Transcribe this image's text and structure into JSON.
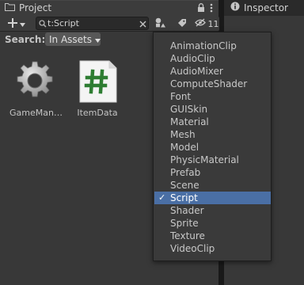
{
  "tabs": {
    "project": "Project",
    "inspector": "Inspector"
  },
  "toolbar": {
    "search_value": "t:Script",
    "hidden_count": "11"
  },
  "searchbar": {
    "label": "Search:",
    "scope": "In Assets"
  },
  "assets": [
    {
      "label": "GameMan…",
      "icon": "gear-icon"
    },
    {
      "label": "ItemData",
      "icon": "csharp-script-icon"
    }
  ],
  "dropdown": {
    "items": [
      "AnimationClip",
      "AudioClip",
      "AudioMixer",
      "ComputeShader",
      "Font",
      "GUISkin",
      "Material",
      "Mesh",
      "Model",
      "PhysicMaterial",
      "Prefab",
      "Scene",
      "Script",
      "Shader",
      "Sprite",
      "Texture",
      "VideoClip"
    ],
    "selected": "Script",
    "check": "✓"
  },
  "colors": {
    "selection": "#4a6fa5",
    "script_hash": "#2e7d32"
  }
}
